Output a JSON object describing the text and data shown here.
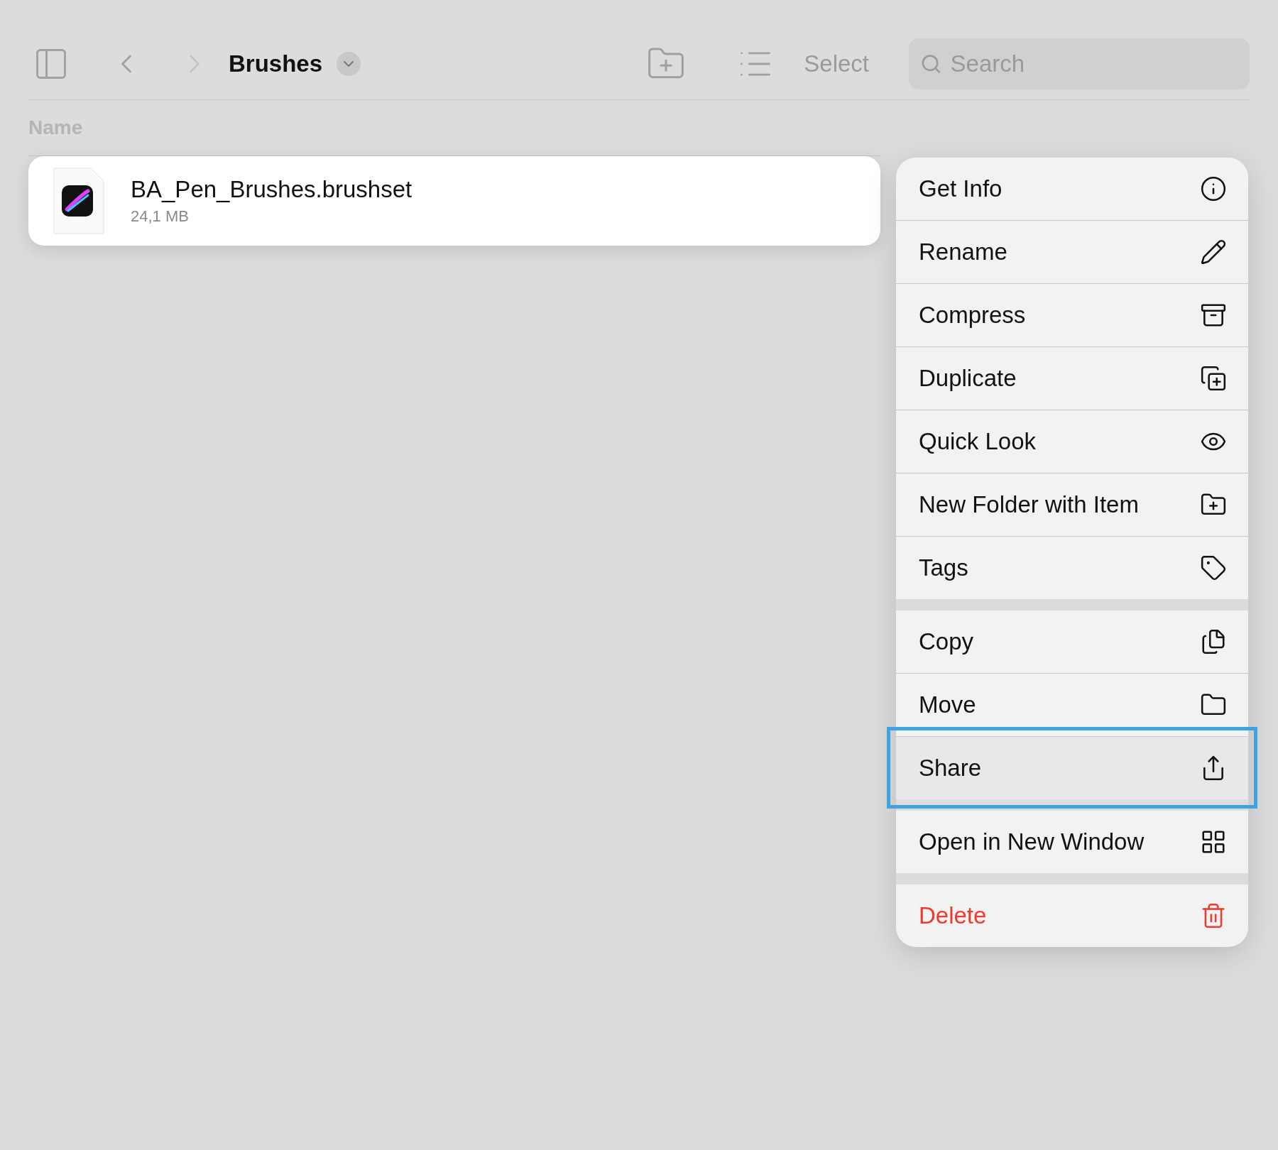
{
  "toolbar": {
    "title": "Brushes",
    "select": "Select",
    "search": {
      "placeholder": "Search"
    }
  },
  "list": {
    "column": "Name",
    "files": [
      {
        "name": "BA_Pen_Brushes.brushset",
        "size": "24,1 MB",
        "selected": true
      }
    ]
  },
  "context_menu": {
    "groups": [
      {
        "items": [
          {
            "label": "Get Info",
            "kind": "normal",
            "highlighted": false
          },
          {
            "label": "Rename",
            "kind": "normal",
            "highlighted": false
          },
          {
            "label": "Compress",
            "kind": "normal",
            "highlighted": false
          },
          {
            "label": "Duplicate",
            "kind": "normal",
            "highlighted": false
          },
          {
            "label": "Quick Look",
            "kind": "normal",
            "highlighted": false
          },
          {
            "label": "New Folder with Item",
            "kind": "normal",
            "highlighted": false
          },
          {
            "label": "Tags",
            "kind": "normal",
            "highlighted": false
          }
        ]
      },
      {
        "items": [
          {
            "label": "Copy",
            "kind": "normal",
            "highlighted": false
          },
          {
            "label": "Move",
            "kind": "normal",
            "highlighted": false
          },
          {
            "label": "Share",
            "kind": "normal",
            "highlighted": true
          }
        ]
      },
      {
        "items": [
          {
            "label": "Open in New Window",
            "kind": "normal"
          }
        ]
      },
      {
        "items": [
          {
            "label": "Delete",
            "kind": "destructive"
          }
        ]
      }
    ]
  }
}
